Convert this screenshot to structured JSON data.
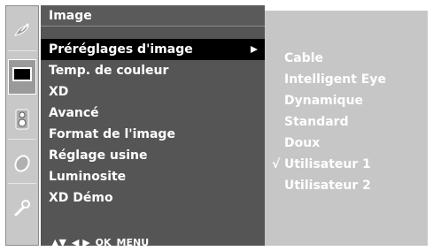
{
  "menu": {
    "title": "Image",
    "items": [
      {
        "label": "Préréglages d'image",
        "has_submenu": true,
        "selected": true
      },
      {
        "label": "Temp. de couleur"
      },
      {
        "label": "XD"
      },
      {
        "label": "Avancé"
      },
      {
        "label": "Format de l'image"
      },
      {
        "label": "Réglage usine"
      },
      {
        "label": "Luminosite"
      },
      {
        "label": "XD Démo"
      }
    ]
  },
  "submenu": {
    "items": [
      {
        "label": "Cable",
        "check": ""
      },
      {
        "label": "Intelligent Eye",
        "check": ""
      },
      {
        "label": "Dynamique",
        "check": ""
      },
      {
        "label": "Standard",
        "check": ""
      },
      {
        "label": "Doux",
        "check": ""
      },
      {
        "label": "Utilisateur 1",
        "check": "√"
      },
      {
        "label": "Utilisateur 2",
        "check": ""
      }
    ]
  },
  "navbar": {
    "updown": "▲▼",
    "leftright": "◀ ▶",
    "ok": "OK",
    "menu": "MENU"
  },
  "icons": [
    "satellite-dish-icon",
    "picture-icon",
    "speaker-icon",
    "clock-icon",
    "wrench-icon"
  ],
  "colors": {
    "menu_bg": "#555555",
    "selected_bg": "#000000",
    "submenu_bg": "#c6c6c6",
    "iconbar_bg": "#c8c8c8",
    "text": "#ffffff"
  }
}
